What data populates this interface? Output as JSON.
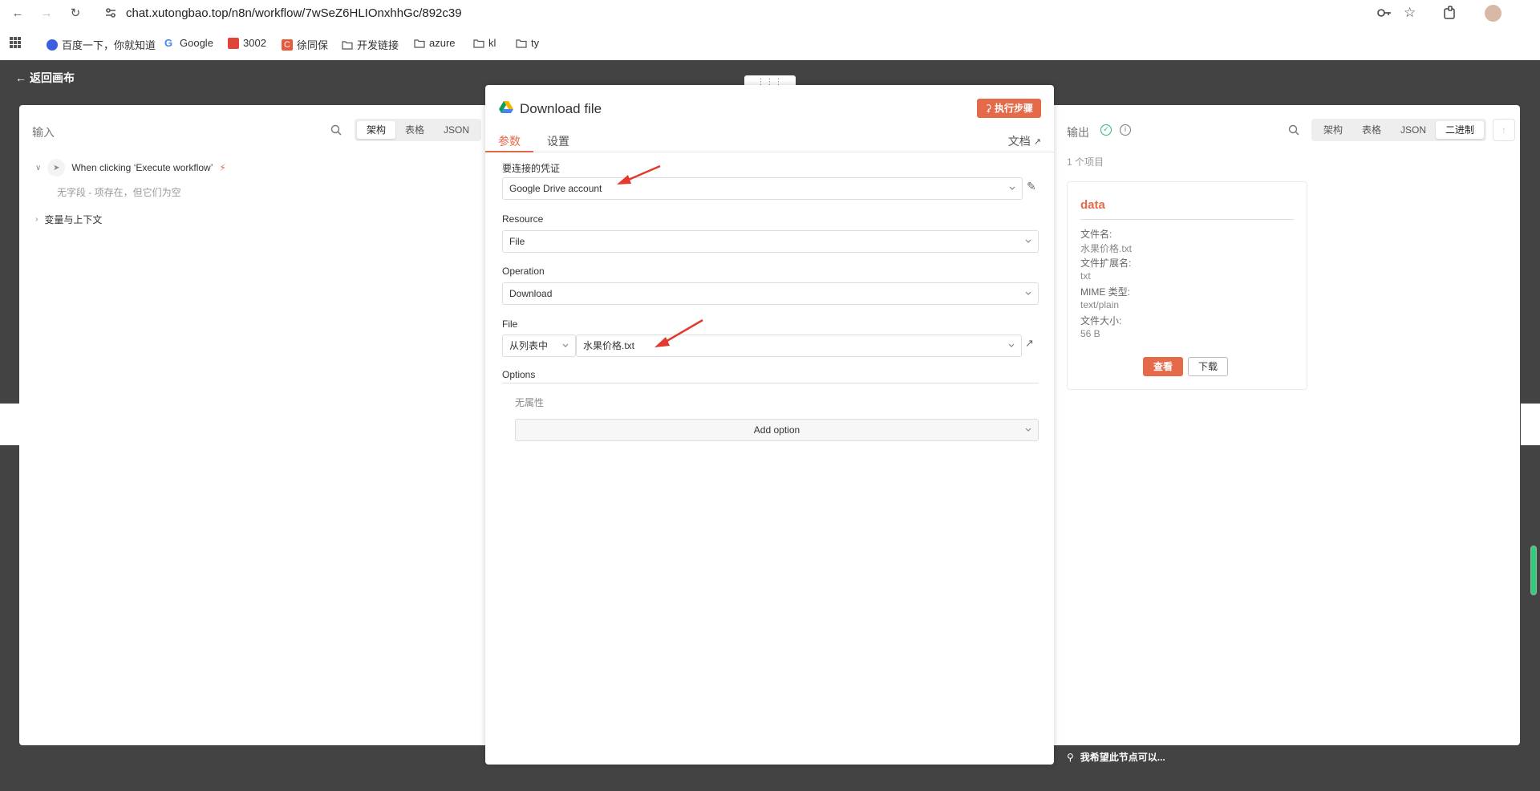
{
  "browser": {
    "url": "chat.xutongbao.top/n8n/workflow/7wSeZ6HLIOnxhhGc/892c39",
    "bookmarks": [
      "百度一下，你就知道",
      "Google",
      "3002",
      "徐同保",
      "开发链接",
      "azure",
      "kl",
      "ty"
    ]
  },
  "app": {
    "back_label": "返回画布",
    "bottom_hint": "我希望此节点可以..."
  },
  "input_panel": {
    "title": "输入",
    "tabs": [
      "架构",
      "表格",
      "JSON"
    ],
    "active_tab": "架构",
    "trigger_node": "When clicking ‘Execute workflow’",
    "empty_note": "无字段 - 项存在，但它们为空",
    "variables_label": "变量与上下文"
  },
  "modal": {
    "title": "Download file",
    "run_button": "执行步骤",
    "tabs": [
      "参数",
      "设置"
    ],
    "active_tab": "参数",
    "docs_label": "文档",
    "credential_label": "要连接的凭证",
    "credential_value": "Google Drive account",
    "resource_label": "Resource",
    "resource_value": "File",
    "operation_label": "Operation",
    "operation_value": "Download",
    "file_label": "File",
    "file_mode": "从列表中",
    "file_value": "水果价格.txt",
    "options_label": "Options",
    "no_properties": "无属性",
    "add_option": "Add option"
  },
  "output_panel": {
    "title": "输出",
    "tabs": [
      "架构",
      "表格",
      "JSON",
      "二进制"
    ],
    "active_tab": "二进制",
    "item_count": "1 个项目",
    "card": {
      "title": "data",
      "fields": [
        {
          "label": "文件名:",
          "value": "水果价格.txt"
        },
        {
          "label": "文件扩展名:",
          "value": "txt"
        },
        {
          "label": "MIME 类型:",
          "value": "text/plain"
        },
        {
          "label": "文件大小:",
          "value": "56 B"
        }
      ],
      "view_button": "查看",
      "download_button": "下载"
    }
  },
  "colors": {
    "accent": "#e46a4a",
    "backdrop": "#434343",
    "success": "#2ecf7a"
  }
}
